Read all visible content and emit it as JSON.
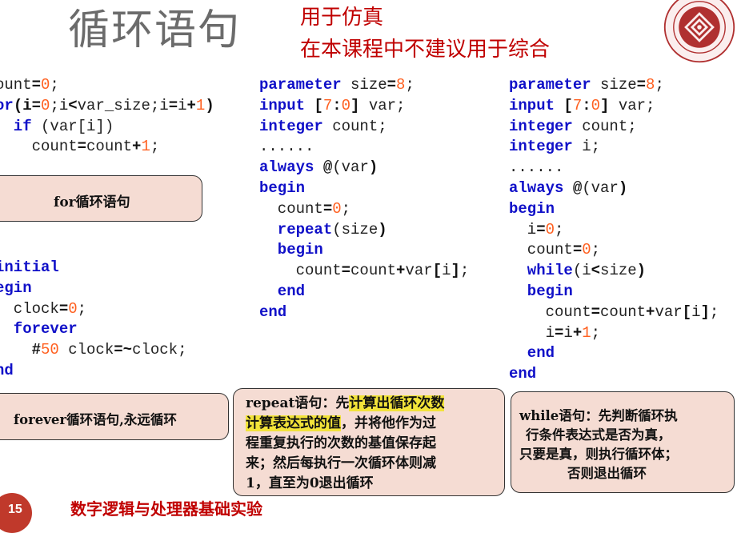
{
  "header": {
    "title": "循环语句",
    "subtitle_line1": "用于仿真",
    "subtitle_line2": "在本课程中不建议用于综合"
  },
  "code_for": {
    "l1a": "ount",
    "l1b": "=",
    "l1c": "0",
    "l1d": ";",
    "l2a": "or",
    "l2b": "(i",
    "l2c": "=",
    "l2d": "0",
    "l2e": ";i",
    "l2f": "<",
    "l2g": "var_size;i",
    "l2h": "=",
    "l2i": "i",
    "l2j": "+",
    "l2k": "1",
    "l2l": ")",
    "l3a": "  if",
    "l3b": " (var[i])",
    "l4a": "    count",
    "l4b": "=",
    "l4c": "count",
    "l4d": "+",
    "l4e": "1",
    "l4f": ";"
  },
  "code_forever": {
    "l1": "initial",
    "l2": "egin",
    "l3a": "  clock",
    "l3b": "=",
    "l3c": "0",
    "l3d": ";",
    "l4": "  forever",
    "l5a": "    ",
    "l5b": "#",
    "l5c": "50",
    "l5d": " clock",
    "l5e": "=~",
    "l5f": "clock;",
    "l6": "nd"
  },
  "code_repeat": {
    "l1a": "parameter",
    "l1b": " size",
    "l1c": "=",
    "l1d": "8",
    "l1e": ";",
    "l2a": "input",
    "l2b": " [",
    "l2c": "7",
    "l2d": ":",
    "l2e": "0",
    "l2f": "]",
    "l2g": " var;",
    "l3a": "integer",
    "l3b": " count;",
    "l4": "......",
    "l5a": "always",
    "l5b": " @",
    "l5c": "(var",
    "l5d": ")",
    "l6": "begin",
    "l7a": "  count",
    "l7b": "=",
    "l7c": "0",
    "l7d": ";",
    "l8a": "  repeat",
    "l8b": "(size",
    "l8c": ")",
    "l9": "  begin",
    "l10a": "    count",
    "l10b": "=",
    "l10c": "count",
    "l10d": "+",
    "l10e": "var",
    "l10f": "[",
    "l10g": "i",
    "l10h": "]",
    "l10i": ";",
    "l11": "  end",
    "l12": "end"
  },
  "code_while": {
    "l1a": "parameter",
    "l1b": " size",
    "l1c": "=",
    "l1d": "8",
    "l1e": ";",
    "l2a": "input",
    "l2b": " [",
    "l2c": "7",
    "l2d": ":",
    "l2e": "0",
    "l2f": "]",
    "l2g": " var;",
    "l3a": "integer",
    "l3b": " count;",
    "l4a": "integer",
    "l4b": " i;",
    "l5": "......",
    "l6a": "always",
    "l6b": " @",
    "l6c": "(var",
    "l6d": ")",
    "l7": "begin",
    "l8a": "  i",
    "l8b": "=",
    "l8c": "0",
    "l8d": ";",
    "l9a": "  count",
    "l9b": "=",
    "l9c": "0",
    "l9d": ";",
    "l10a": "  while",
    "l10b": "(i",
    "l10c": "<",
    "l10d": "size",
    "l10e": ")",
    "l11": "  begin",
    "l12a": "    count",
    "l12b": "=",
    "l12c": "count",
    "l12d": "+",
    "l12e": "var",
    "l12f": "[",
    "l12g": "i",
    "l12h": "]",
    "l12i": ";",
    "l13a": "    i",
    "l13b": "=",
    "l13c": "i",
    "l13d": "+",
    "l13e": "1",
    "l13f": ";",
    "l14": "  end",
    "l15": "end"
  },
  "boxes": {
    "for_label": "for循环语句",
    "forever_label": "forever循环语句,永远循环",
    "repeat_pre": "repeat语句：先",
    "repeat_hl1": "计算出循环次数",
    "repeat_hl2": "计算表达式的值",
    "repeat_rest1": "，并将他作为过",
    "repeat_line3": "程重复执行的次数的基值保存起",
    "repeat_line4": "来；然后每执行一次循环体则减",
    "repeat_line5": "1，直至为0退出循环",
    "while_line1": "while语句：先判断循环执",
    "while_line2": "行条件表达式是否为真，",
    "while_line3": "只要是真，则执行循环体；",
    "while_line4": "否则退出循环"
  },
  "footer": {
    "page_number": "15",
    "course": "数字逻辑与处理器基础实验"
  },
  "colors": {
    "keyword": "#1010c8",
    "number": "#ff6020",
    "accent": "#c00000",
    "box_fill": "#f5dcd3",
    "highlight": "#f2e33a"
  }
}
